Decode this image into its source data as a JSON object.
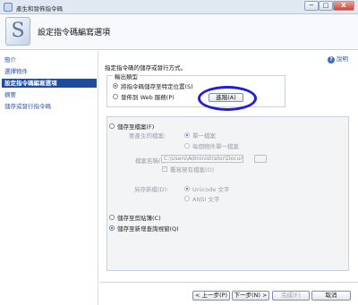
{
  "window": {
    "title": "產生和發佈指令碼",
    "minimize_label": "─",
    "maximize_label": "□",
    "close_label": "X"
  },
  "header": {
    "title": "設定指令碼編寫選項"
  },
  "sidebar": {
    "items": [
      {
        "label": "簡介",
        "active": false
      },
      {
        "label": "選擇物件",
        "active": false
      },
      {
        "label": "設定指令碼編寫選項",
        "active": true
      },
      {
        "label": "摘要",
        "active": false
      },
      {
        "label": "儲存或發行指令碼",
        "active": false
      }
    ]
  },
  "main": {
    "help_label": "說明",
    "prompt": "指定指令碼的儲存或發行方式。",
    "output_type": {
      "legend": "輸出類型",
      "options": [
        "將指令碼儲存至特定位置(S)",
        "發佈到 Web 服務(P)"
      ],
      "selected": 0
    },
    "save_to_file": {
      "label": "儲存至檔案(F)",
      "browse_button": "進階(A)",
      "files_to_generate_label": "要產生的檔案:",
      "single_file": "單一檔案",
      "file_per_object": "每個物件單一檔案",
      "file_name_label": "檔案名稱(I):",
      "file_name_value": "C:\\Users\\Administrator\\Documents\\script.sql",
      "overwrite_label": "覆寫現有檔案(O)",
      "overwrite_checked": true,
      "save_as_label": "另存新檔(D):",
      "unicode": "Unicode 文字",
      "ansi": "ANSI 文字"
    },
    "clipboard_label": "儲存至剪貼簿(C)",
    "new_query_label": "儲存至新增查詢視窗(Q)",
    "selected_destination": "new_query"
  },
  "footer": {
    "back": "< 上一步(P)",
    "next": "下一步(N) >",
    "finish": "完成(F)",
    "cancel": "取消"
  },
  "colors": {
    "annotation_circle": "#1f1fd6",
    "active_nav": "#1f4b9e"
  }
}
